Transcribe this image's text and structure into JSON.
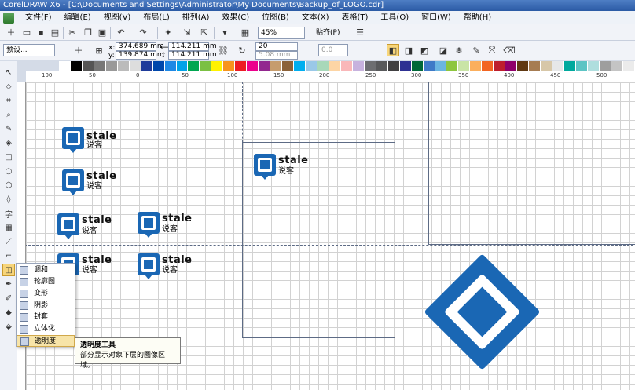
{
  "title": "CorelDRAW X6 - [C:\\Documents and Settings\\Administrator\\My Documents\\Backup_of_LOGO.cdr]",
  "menu": [
    "文件(F)",
    "编辑(E)",
    "视图(V)",
    "布局(L)",
    "排列(A)",
    "效果(C)",
    "位图(B)",
    "文本(X)",
    "表格(T)",
    "工具(O)",
    "窗口(W)",
    "帮助(H)"
  ],
  "toolbar": {
    "zoom": "45%",
    "snap": "贴齐(P)"
  },
  "propbar": {
    "preset": "预设...",
    "x": "374.689 mm",
    "y": "139.874 mm",
    "w": "114.211 mm",
    "h": "114.211 mm",
    "sx": "20",
    "sy": "5.08 mm",
    "zero": "0.0"
  },
  "ruler": [
    "100",
    "50",
    "0",
    "50",
    "100",
    "150",
    "200",
    "250",
    "300",
    "350",
    "400",
    "450",
    "500"
  ],
  "logo": {
    "brand": "stale",
    "sub": "说客"
  },
  "flyout": [
    "调和",
    "轮廓图",
    "变形",
    "阴影",
    "封套",
    "立体化",
    "透明度"
  ],
  "tooltip": {
    "title": "透明度工具",
    "desc": "部分显示对象下层的图像区域。"
  },
  "colors": {
    "brand_blue": "#1a67b4",
    "highlight": "#f7d57a"
  }
}
